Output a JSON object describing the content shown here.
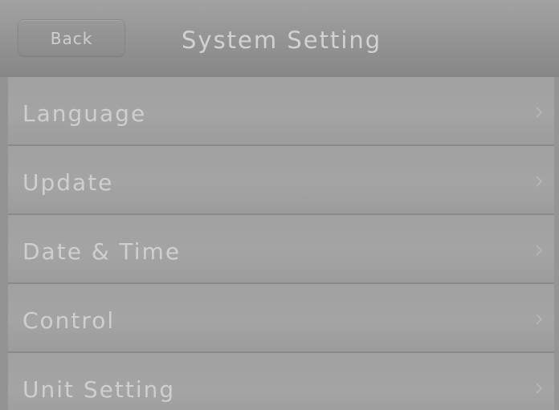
{
  "header": {
    "back_label": "Back",
    "title": "System Setting"
  },
  "menu": {
    "items": [
      {
        "label": "Language",
        "icon": "chevron-right-icon"
      },
      {
        "label": "Update",
        "icon": "chevron-right-icon"
      },
      {
        "label": "Date & Time",
        "icon": "chevron-right-icon"
      },
      {
        "label": "Control",
        "icon": "chevron-right-icon"
      },
      {
        "label": "Unit Setting",
        "icon": "chevron-right-icon"
      }
    ]
  },
  "colors": {
    "background": "#9c9c9c",
    "text": "#cfcfcf",
    "divider": "#8a8a8a"
  }
}
